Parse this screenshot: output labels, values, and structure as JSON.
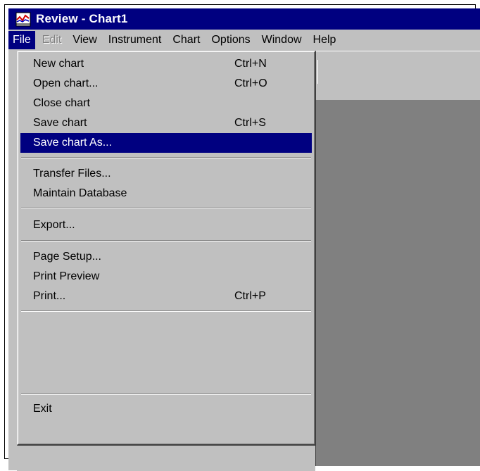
{
  "window": {
    "title": "Review - Chart1"
  },
  "menubar": {
    "items": [
      {
        "label": "File",
        "state": "active"
      },
      {
        "label": "Edit",
        "state": "disabled"
      },
      {
        "label": "View",
        "state": "normal"
      },
      {
        "label": "Instrument",
        "state": "normal"
      },
      {
        "label": "Chart",
        "state": "normal"
      },
      {
        "label": "Options",
        "state": "normal"
      },
      {
        "label": "Window",
        "state": "normal"
      },
      {
        "label": "Help",
        "state": "normal"
      }
    ]
  },
  "file_menu": {
    "new_chart": {
      "label": "New chart",
      "shortcut": "Ctrl+N"
    },
    "open_chart": {
      "label": "Open chart...",
      "shortcut": "Ctrl+O"
    },
    "close_chart": {
      "label": "Close chart",
      "shortcut": ""
    },
    "save_chart": {
      "label": "Save chart",
      "shortcut": "Ctrl+S"
    },
    "save_chart_as": {
      "label": "Save chart As...",
      "shortcut": ""
    },
    "transfer_files": {
      "label": "Transfer Files...",
      "shortcut": ""
    },
    "maintain_database": {
      "label": "Maintain Database",
      "shortcut": ""
    },
    "export": {
      "label": "Export...",
      "shortcut": ""
    },
    "page_setup": {
      "label": "Page Setup...",
      "shortcut": ""
    },
    "print_preview": {
      "label": "Print Preview",
      "shortcut": ""
    },
    "print": {
      "label": "Print...",
      "shortcut": "Ctrl+P"
    },
    "exit": {
      "label": "Exit",
      "shortcut": ""
    }
  },
  "colors": {
    "titlebar": "#000080",
    "selection": "#000080",
    "face": "#c0c0c0",
    "workspace": "#808080"
  },
  "icons": {
    "app_icon": "review-app-icon"
  }
}
